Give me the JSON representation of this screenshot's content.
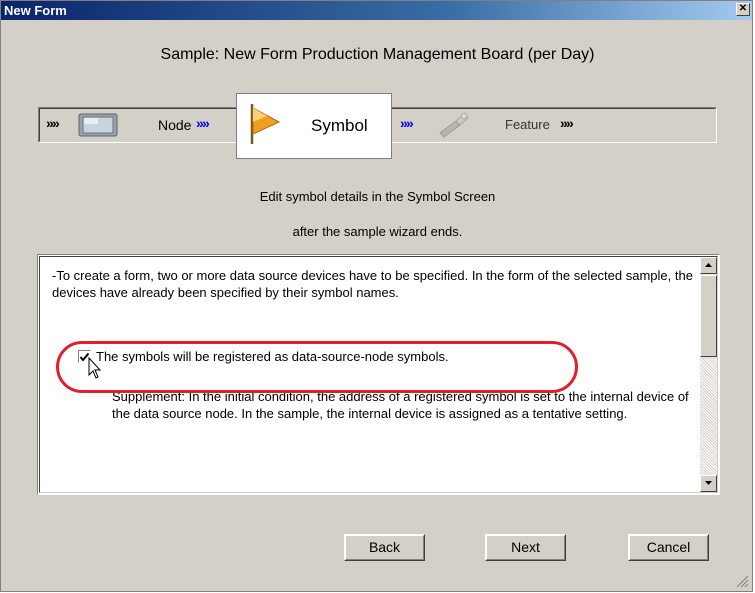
{
  "window": {
    "title": "New Form",
    "close_glyph": "✕"
  },
  "header": {
    "subtitle": "Sample: New Form Production Management Board (per Day)"
  },
  "steps": {
    "items": [
      {
        "label": "Node",
        "icon": "monitor-icon",
        "state": "done"
      },
      {
        "label": "Symbol",
        "icon": "flag-icon",
        "state": "active"
      },
      {
        "label": "Feature",
        "icon": "tool-icon",
        "state": "pending"
      }
    ],
    "chevron": "»",
    "active_color": "#0000ff"
  },
  "help": {
    "line1": "Edit symbol details in the Symbol Screen",
    "line2": "after the sample wizard ends."
  },
  "content": {
    "paragraph": "-To create a form, two or more data source devices have to be specified. In the form of the selected sample, the devices have already been specified by their symbol names.",
    "checkbox_label": "The symbols will be registered as data-source-node symbols.",
    "checkbox_checked": true,
    "supplement": "Supplement: In the initial condition, the address of a registered symbol is set to the internal device of the data source node. In the sample, the internal device is assigned as a tentative setting."
  },
  "highlight_color": "#e0202a",
  "buttons": {
    "back": "Back",
    "next": "Next",
    "cancel": "Cancel"
  }
}
